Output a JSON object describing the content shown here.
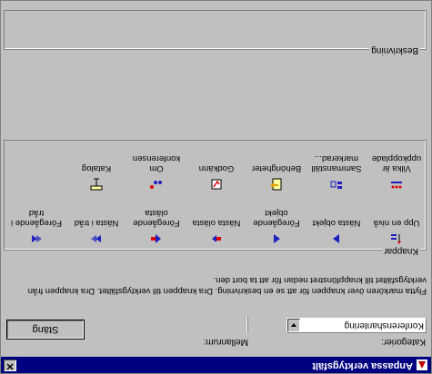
{
  "window": {
    "title": "Anpassa verktygsfält",
    "close_glyph": "✕"
  },
  "categories": {
    "label": "Kategorier:",
    "value": "Konferenshantering"
  },
  "spacing": {
    "label": "Mellanrum:"
  },
  "close_button": {
    "label": "Stäng"
  },
  "instructions": "Flytta markören över knappen för att se en beskrivning. Dra knappen till verktygsfältet. Dra knappen från verktygsfältet till knappfönstret nedan för att ta bort den.",
  "buttons_group": {
    "label": "Knappar"
  },
  "description_group": {
    "label": "Beskrivning"
  },
  "buttons": [
    {
      "label": "Upp en nivå",
      "icon": "up-level-icon"
    },
    {
      "label": "Nästa objekt",
      "icon": "next-object-icon"
    },
    {
      "label": "Föregående objekt",
      "icon": "previous-object-icon"
    },
    {
      "label": "Nästa olästa",
      "icon": "next-unread-icon"
    },
    {
      "label": "Föregående olästa",
      "icon": "previous-unread-icon"
    },
    {
      "label": "Nästa i tråd",
      "icon": "next-in-thread-icon"
    },
    {
      "label": "Föregående i tråd",
      "icon": "previous-in-thread-icon"
    },
    {
      "label": "Vilka är uppkopplade",
      "icon": "who-online-icon"
    },
    {
      "label": "Sammanställ markerad...",
      "icon": "compile-selected-icon"
    },
    {
      "label": "Behörigheter",
      "icon": "permissions-icon"
    },
    {
      "label": "Godkänn",
      "icon": "approve-icon"
    },
    {
      "label": "Om konferensen",
      "icon": "about-conference-icon"
    },
    {
      "label": "Katalog",
      "icon": "catalog-icon"
    }
  ],
  "colors": {
    "title_bar": "#000080",
    "face": "#c0c0c0",
    "icon_blue": "#2020c0",
    "icon_red": "#e00000"
  }
}
